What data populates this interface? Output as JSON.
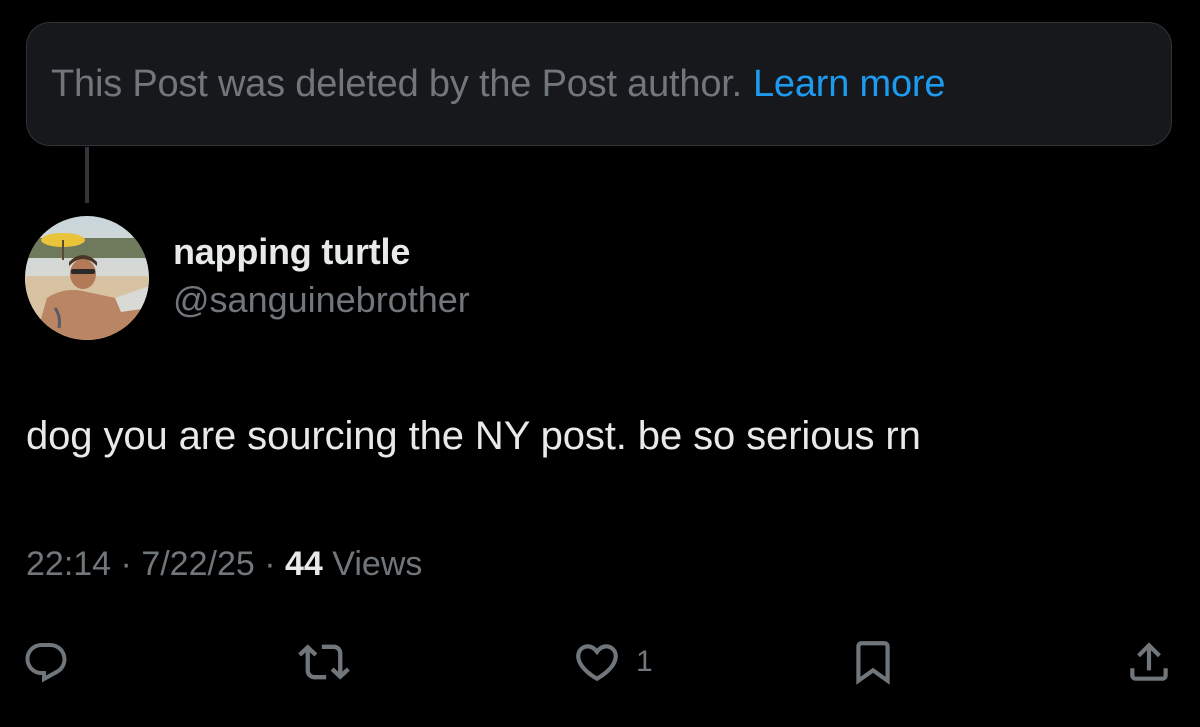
{
  "deleted_notice": {
    "text": "This Post was deleted by the Post author.",
    "link_label": "Learn more"
  },
  "author": {
    "display_name": "napping turtle",
    "handle": "@sanguinebrother"
  },
  "post": {
    "text": "dog you are sourcing the NY post. be so serious rn"
  },
  "meta": {
    "time": "22:14",
    "separator": "·",
    "date": "7/22/25",
    "views_count": "44",
    "views_label": "Views"
  },
  "actions": {
    "reply_icon": "reply-icon",
    "repost_icon": "repost-icon",
    "like_icon": "heart-icon",
    "like_count": "1",
    "bookmark_icon": "bookmark-icon",
    "share_icon": "share-icon"
  },
  "colors": {
    "background": "#000000",
    "text_primary": "#e7e9ea",
    "text_secondary": "#71767b",
    "link": "#1d9bf0",
    "card_background": "#16181c",
    "border": "#2f3336"
  }
}
